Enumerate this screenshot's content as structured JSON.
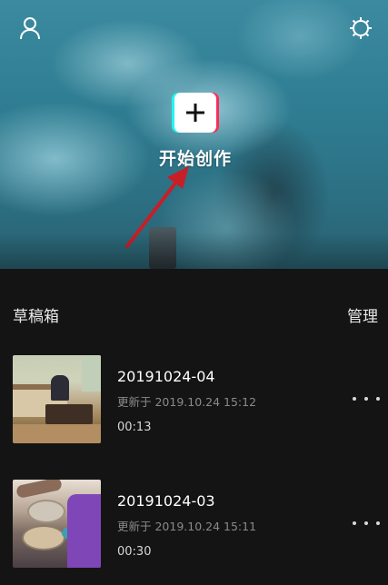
{
  "hero": {
    "create_label": "开始创作",
    "icons": {
      "profile": "user-outline-icon",
      "settings": "gear-icon",
      "create": "plus-icon"
    },
    "colors": {
      "accent_cyan": "#24f4ee",
      "accent_pink": "#fe2c55",
      "arrow": "#c81e28"
    }
  },
  "drafts": {
    "title": "草稿箱",
    "manage_label": "管理",
    "items": [
      {
        "name": "20191024-04",
        "updated": "更新于 2019.10.24 15:12",
        "duration": "00:13",
        "thumbnail": "living-room-photo",
        "more_icon": "more-horizontal-icon"
      },
      {
        "name": "20191024-03",
        "updated": "更新于 2019.10.24 15:11",
        "duration": "00:30",
        "thumbnail": "dinner-table-photo",
        "more_icon": "more-horizontal-icon"
      }
    ]
  }
}
